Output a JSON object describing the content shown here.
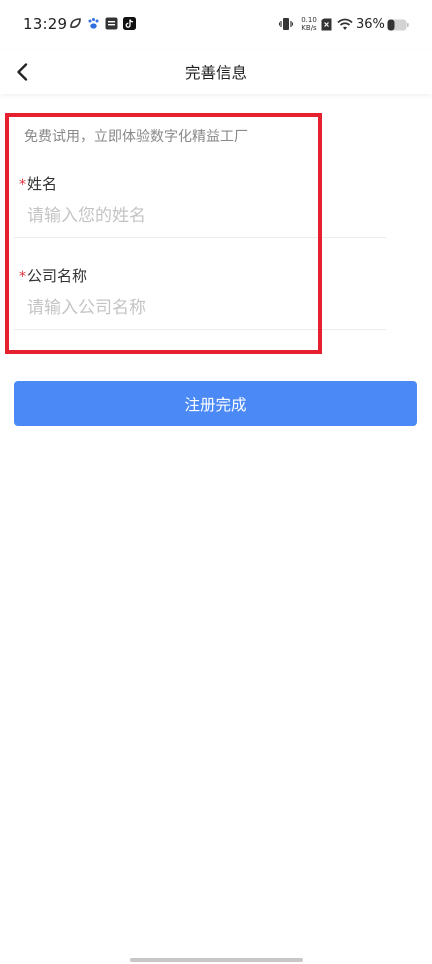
{
  "status_bar": {
    "time": "13:29",
    "net_speed_value": "0.10",
    "net_speed_unit": "KB/s",
    "battery_percent": "36%"
  },
  "header": {
    "title": "完善信息"
  },
  "form": {
    "hint": "免费试用，立即体验数字化精益工厂",
    "required_mark": "*",
    "name_label": "姓名",
    "name_placeholder": "请输入您的姓名",
    "name_value": "",
    "company_label": "公司名称",
    "company_placeholder": "请输入公司名称",
    "company_value": ""
  },
  "actions": {
    "submit_label": "注册完成"
  },
  "colors": {
    "primary_button": "#4b89f7",
    "required_asterisk": "#e0313b",
    "highlight_border": "#e5212f"
  }
}
